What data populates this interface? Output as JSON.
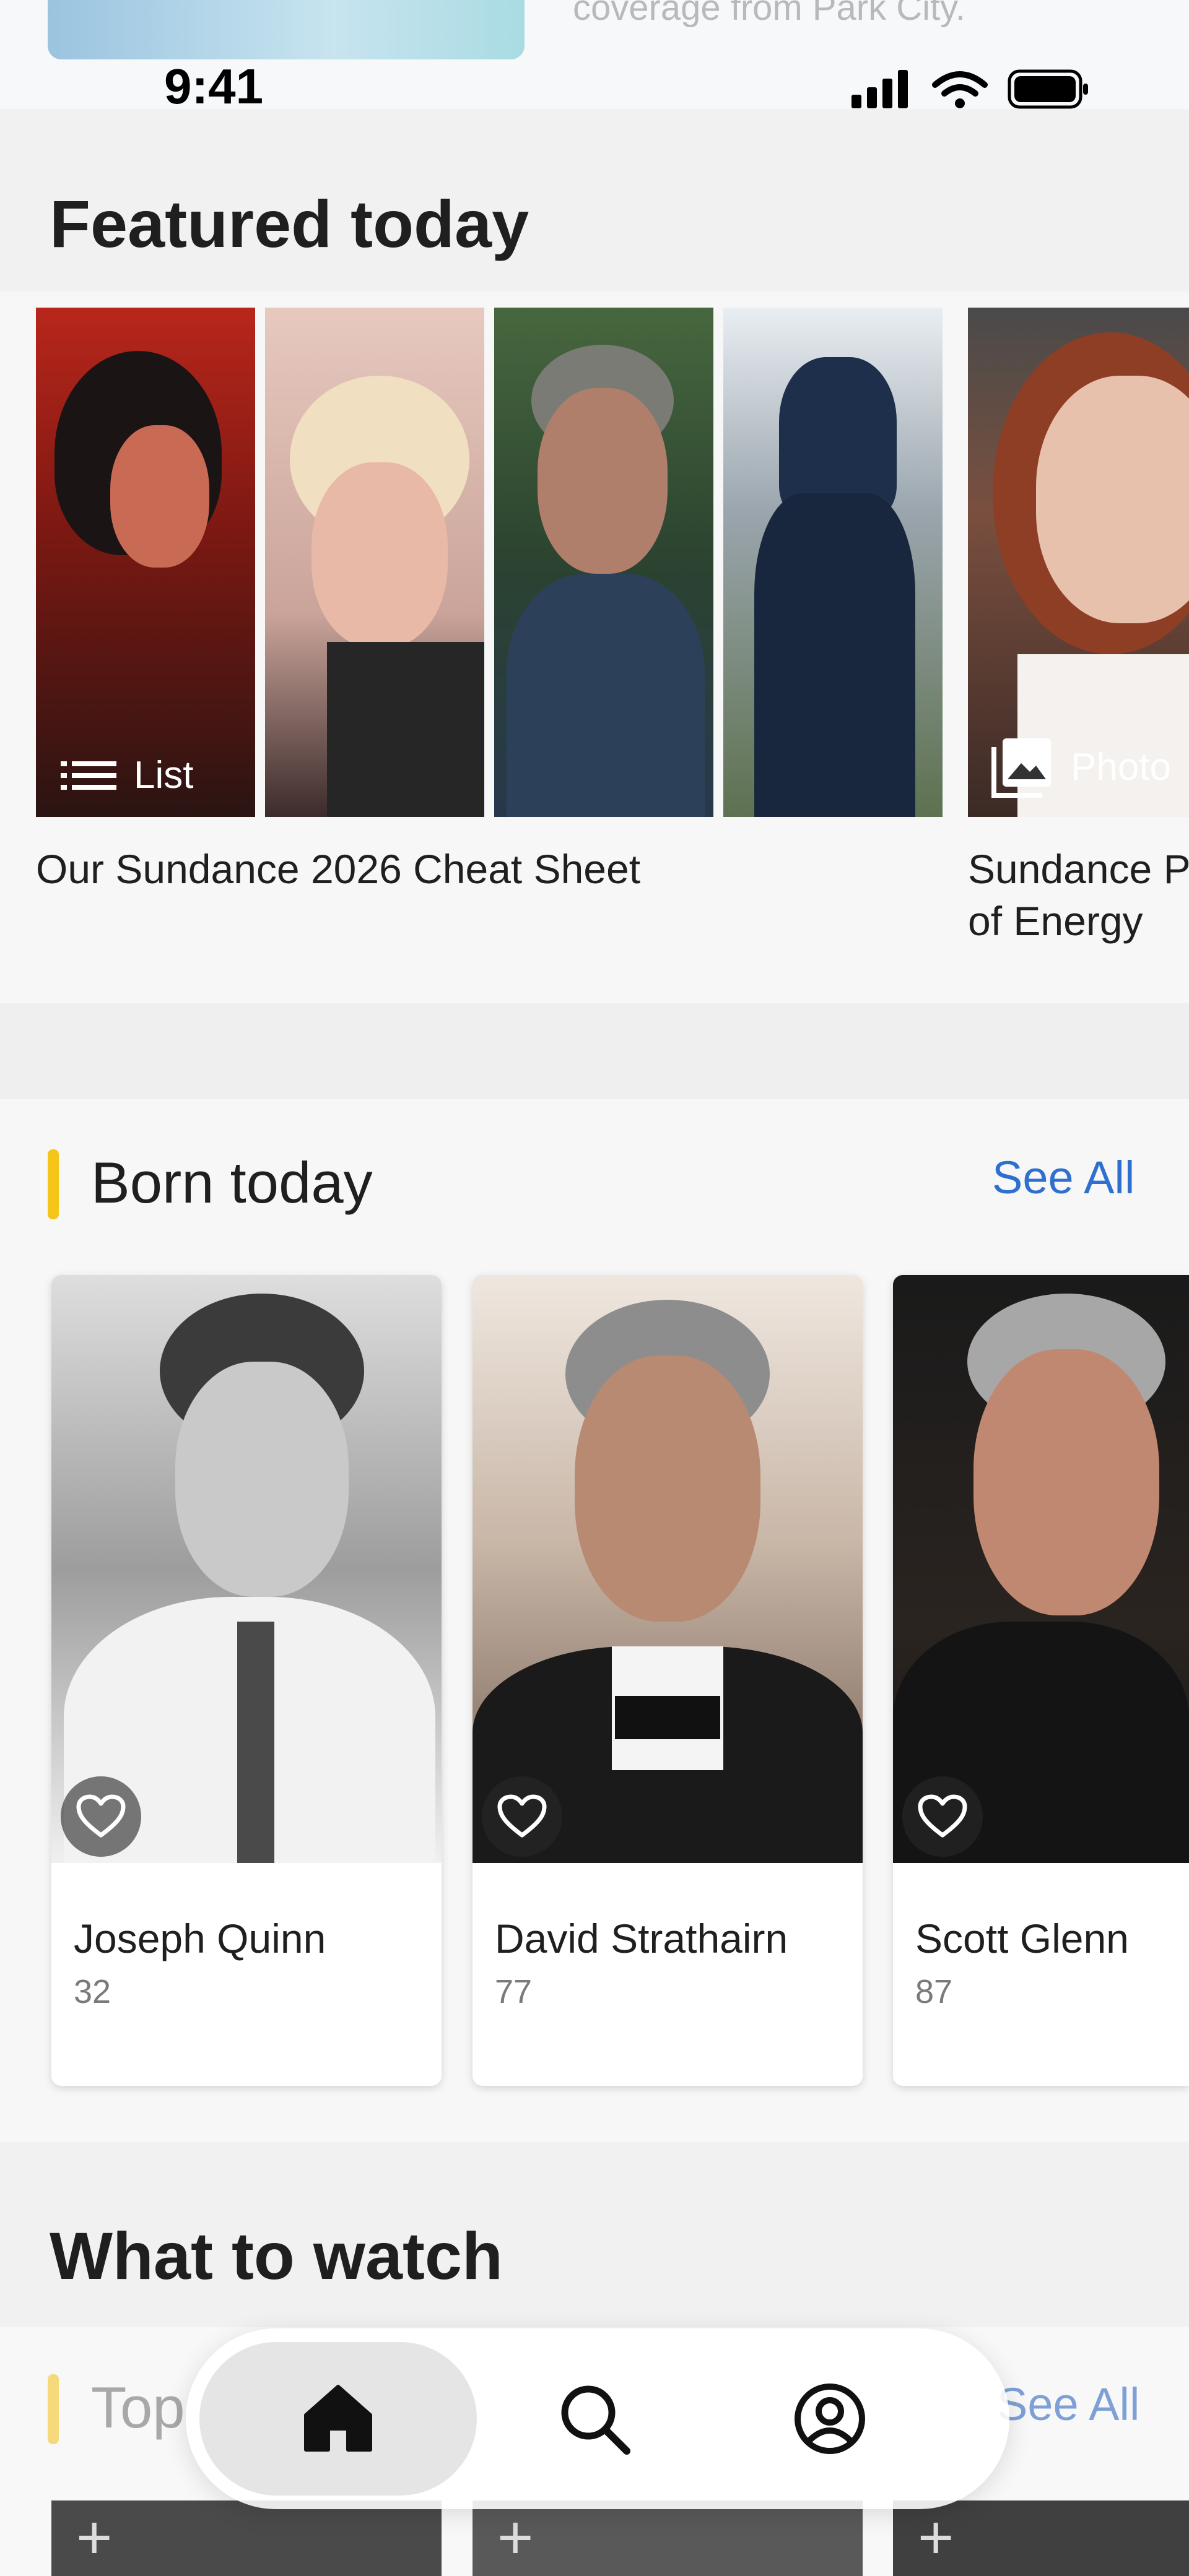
{
  "top_peek": {
    "text": "coverage from Park City."
  },
  "status_bar": {
    "time": "9:41"
  },
  "featured": {
    "title": "Featured today",
    "cards": [
      {
        "badge": "List",
        "caption": "Our Sundance 2026 Cheat Sheet",
        "badge_icon": "list-icon"
      },
      {
        "badge": "Photo",
        "caption": "Sundance P\nof Energy",
        "badge_icon": "photo-icon"
      }
    ]
  },
  "born_today": {
    "title": "Born today",
    "see_all": "See All",
    "people": [
      {
        "name": "Joseph Quinn",
        "age": "32"
      },
      {
        "name": "David Strathairn",
        "age": "77"
      },
      {
        "name": "Scott Glenn",
        "age": "87"
      }
    ]
  },
  "what_to_watch": {
    "title": "What to watch",
    "subsection_title": "Top",
    "see_all": "See All"
  },
  "tab_bar": {
    "items": [
      {
        "name": "home",
        "icon": "home-icon",
        "active": true
      },
      {
        "name": "search",
        "icon": "search-icon",
        "active": false
      },
      {
        "name": "profile",
        "icon": "profile-icon",
        "active": false
      }
    ]
  },
  "colors": {
    "accent": "#f5c518",
    "link": "#2f6fcf"
  }
}
